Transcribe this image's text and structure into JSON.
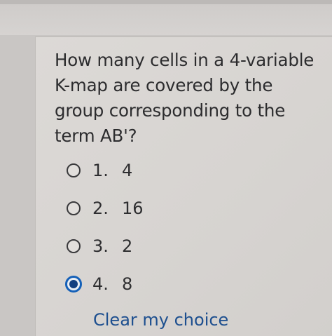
{
  "question": {
    "text": "How many cells in a 4-variable K-map are covered by the group corresponding to the term AB'?"
  },
  "options": [
    {
      "number": "1.",
      "value": "4",
      "selected": false
    },
    {
      "number": "2.",
      "value": "16",
      "selected": false
    },
    {
      "number": "3.",
      "value": "2",
      "selected": false
    },
    {
      "number": "4.",
      "value": "8",
      "selected": true
    }
  ],
  "clear_choice": {
    "label": "Clear my choice"
  },
  "colors": {
    "selected_radio": "#1560b8",
    "link": "#1d4f8f"
  }
}
